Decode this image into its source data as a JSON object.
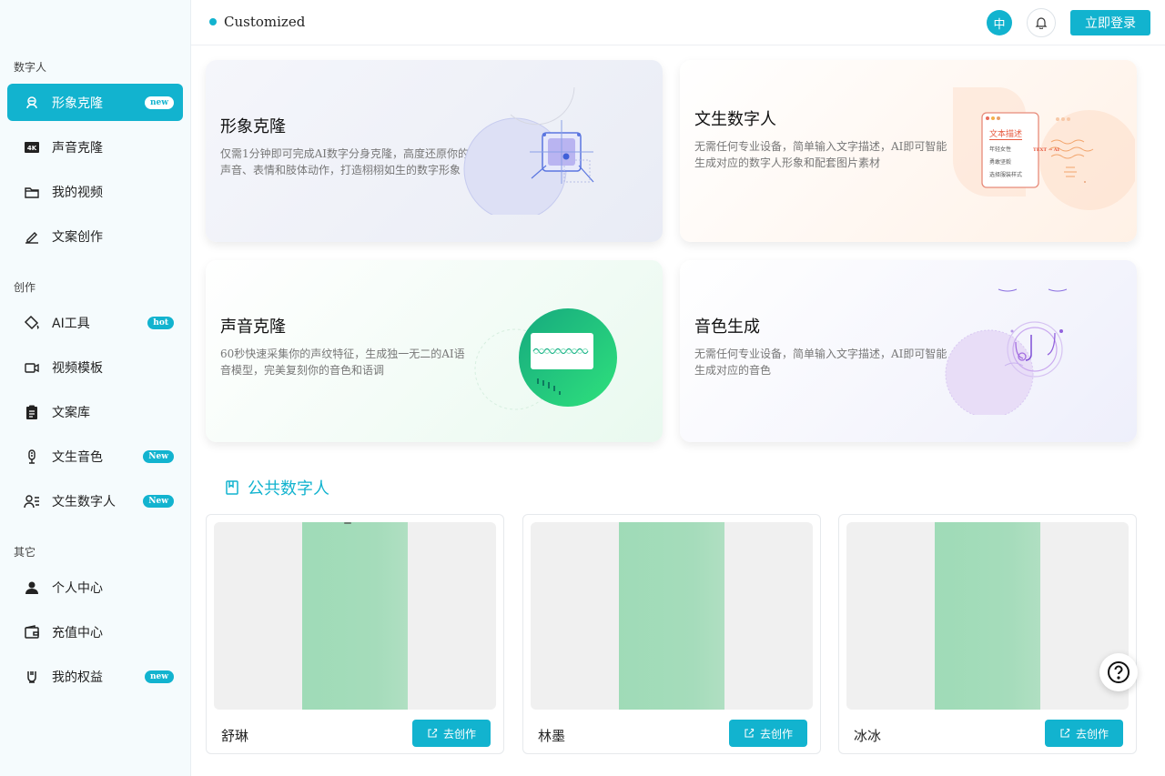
{
  "header": {
    "brand": "Customized",
    "lang_label": "中",
    "login_label": "立即登录"
  },
  "sidebar": {
    "sections": [
      {
        "label": "数字人"
      },
      {
        "label": "创作"
      },
      {
        "label": "其它"
      }
    ],
    "items": [
      {
        "label": "形象克隆",
        "badge": "new",
        "icon": "avatar-clone-icon",
        "active": true
      },
      {
        "label": "声音克隆",
        "badge": "",
        "icon": "4k-icon"
      },
      {
        "label": "我的视频",
        "badge": "",
        "icon": "folder-icon"
      },
      {
        "label": "文案创作",
        "badge": "",
        "icon": "pen-icon"
      },
      {
        "label": "AI工具",
        "badge": "hot",
        "icon": "paint-bucket-icon"
      },
      {
        "label": "视频模板",
        "badge": "",
        "icon": "video-camera-icon"
      },
      {
        "label": "文案库",
        "badge": "",
        "icon": "clipboard-icon"
      },
      {
        "label": "文生音色",
        "badge": "New",
        "icon": "microphone-icon"
      },
      {
        "label": "文生数字人",
        "badge": "New",
        "icon": "user-list-icon"
      },
      {
        "label": "个人中心",
        "badge": "",
        "icon": "user-icon"
      },
      {
        "label": "充值中心",
        "badge": "",
        "icon": "wallet-icon"
      },
      {
        "label": "我的权益",
        "badge": "new",
        "icon": "medal-icon"
      }
    ]
  },
  "features": [
    {
      "title": "形象克隆",
      "desc": "仅需1分钟即可完成AI数字分身克隆，高度还原你的声音、表情和肢体动作，打造栩栩如生的数字形象"
    },
    {
      "title": "文生数字人",
      "desc": "无需任何专业设备，简单输入文字描述，AI即可智能生成对应的数字人形象和配套图片素材"
    },
    {
      "title": "声音克隆",
      "desc": "60秒快速采集你的声纹特征，生成独一无二的AI语音模型，完美复刻你的音色和语调"
    },
    {
      "title": "音色生成",
      "desc": "无需任何专业设备，简单输入文字描述，AI即可智能生成对应的音色"
    }
  ],
  "art_text": {
    "panel_title": "文本描述",
    "line1": "年轻女性",
    "line2": "勇敢坚毅",
    "line3": "选择服装样式",
    "text_tag": "TEXT → AI"
  },
  "public_section": {
    "title": "公共数字人"
  },
  "avatars": [
    {
      "name": "舒琳",
      "button": "去创作"
    },
    {
      "name": "林墨",
      "button": "去创作"
    },
    {
      "name": "冰冰",
      "button": "去创作"
    }
  ],
  "colors": {
    "accent": "#12b3cf",
    "sidebar_bg": "#f5fbfd"
  }
}
